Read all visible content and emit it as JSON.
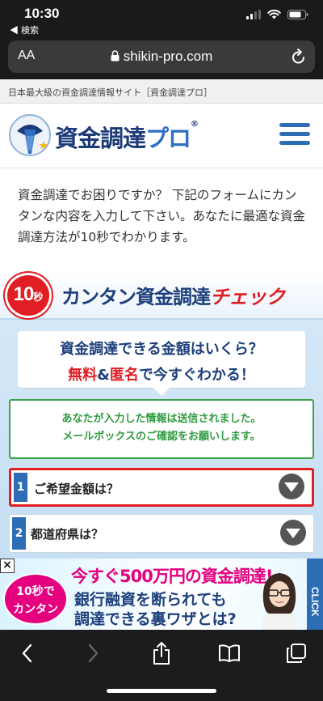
{
  "status_bar": {
    "time": "10:30",
    "back_label": "◀ 検索"
  },
  "browser": {
    "aa_label": "AA",
    "url": "shikin-pro.com"
  },
  "site": {
    "tagline": "日本最大級の資金調達情報サイト［資金調達プロ］",
    "logo_main": "資金調達",
    "logo_pro": "プロ",
    "logo_reg": "®"
  },
  "intro": {
    "text": "資金調達でお困りですか？ 下記のフォームにカンタンな内容を入力して下さい。あなたに最適な資金調達方法が10秒でわかります。"
  },
  "form": {
    "banner_badge_num": "10",
    "banner_badge_unit": "秒",
    "banner_title": "カンタン資金調達",
    "banner_title_check": "チェック",
    "heading_line1": "資金調達できる金額はいくら？",
    "heading_free": "無料",
    "heading_amp": "&",
    "heading_anon": "匿名",
    "heading_rest": "で今すぐわかる！",
    "notice_line1": "あなたが入力した情報は送信されました。",
    "notice_line2": "メールボックスのご確認をお願いします。",
    "questions": [
      {
        "num": "1",
        "label": "ご希望金額は？"
      },
      {
        "num": "2",
        "label": "都道府県は？"
      }
    ]
  },
  "ad": {
    "close": "×",
    "badge_line1": "10秒で",
    "badge_line2": "カンタン",
    "line1": "今すぐ500万円の資金調達!",
    "line2": "銀行融資を断られても",
    "line3": "調達できる裏ワザとは?",
    "click_label": "CLICK"
  },
  "colors": {
    "brand_blue": "#2d6db5",
    "navy": "#1d3f7c",
    "red": "#e01e24",
    "green": "#3aa14a",
    "ad_pink": "#e4007f"
  }
}
